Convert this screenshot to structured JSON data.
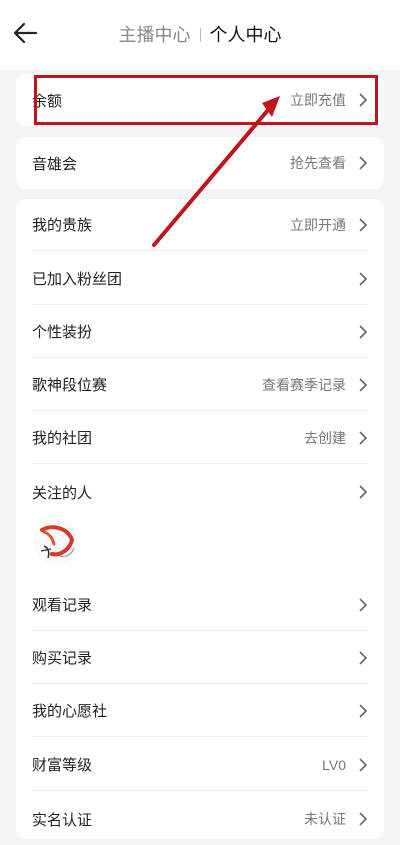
{
  "header": {
    "tab_anchor": "主播中心",
    "tab_personal": "个人中心"
  },
  "rows": {
    "balance": {
      "label": "余额",
      "action": "立即充值"
    },
    "yinxiong": {
      "label": "音雄会",
      "action": "抢先查看"
    },
    "noble": {
      "label": "我的贵族",
      "action": "立即开通"
    },
    "fans_group": {
      "label": "已加入粉丝团"
    },
    "style": {
      "label": "个性装扮"
    },
    "rank": {
      "label": "歌神段位赛",
      "action": "查看赛季记录"
    },
    "club": {
      "label": "我的社团",
      "action": "去创建"
    },
    "following": {
      "label": "关注的人"
    },
    "history": {
      "label": "观看记录"
    },
    "purchase": {
      "label": "购买记录"
    },
    "wish": {
      "label": "我的心愿社"
    },
    "wealth": {
      "label": "财富等级",
      "action": "LV0"
    },
    "realname": {
      "label": "实名认证",
      "action": "未认证"
    }
  },
  "icons": {
    "back": "back-arrow-icon",
    "chevron": "chevron-right-icon"
  },
  "colors": {
    "annotation": "#c0151b"
  }
}
